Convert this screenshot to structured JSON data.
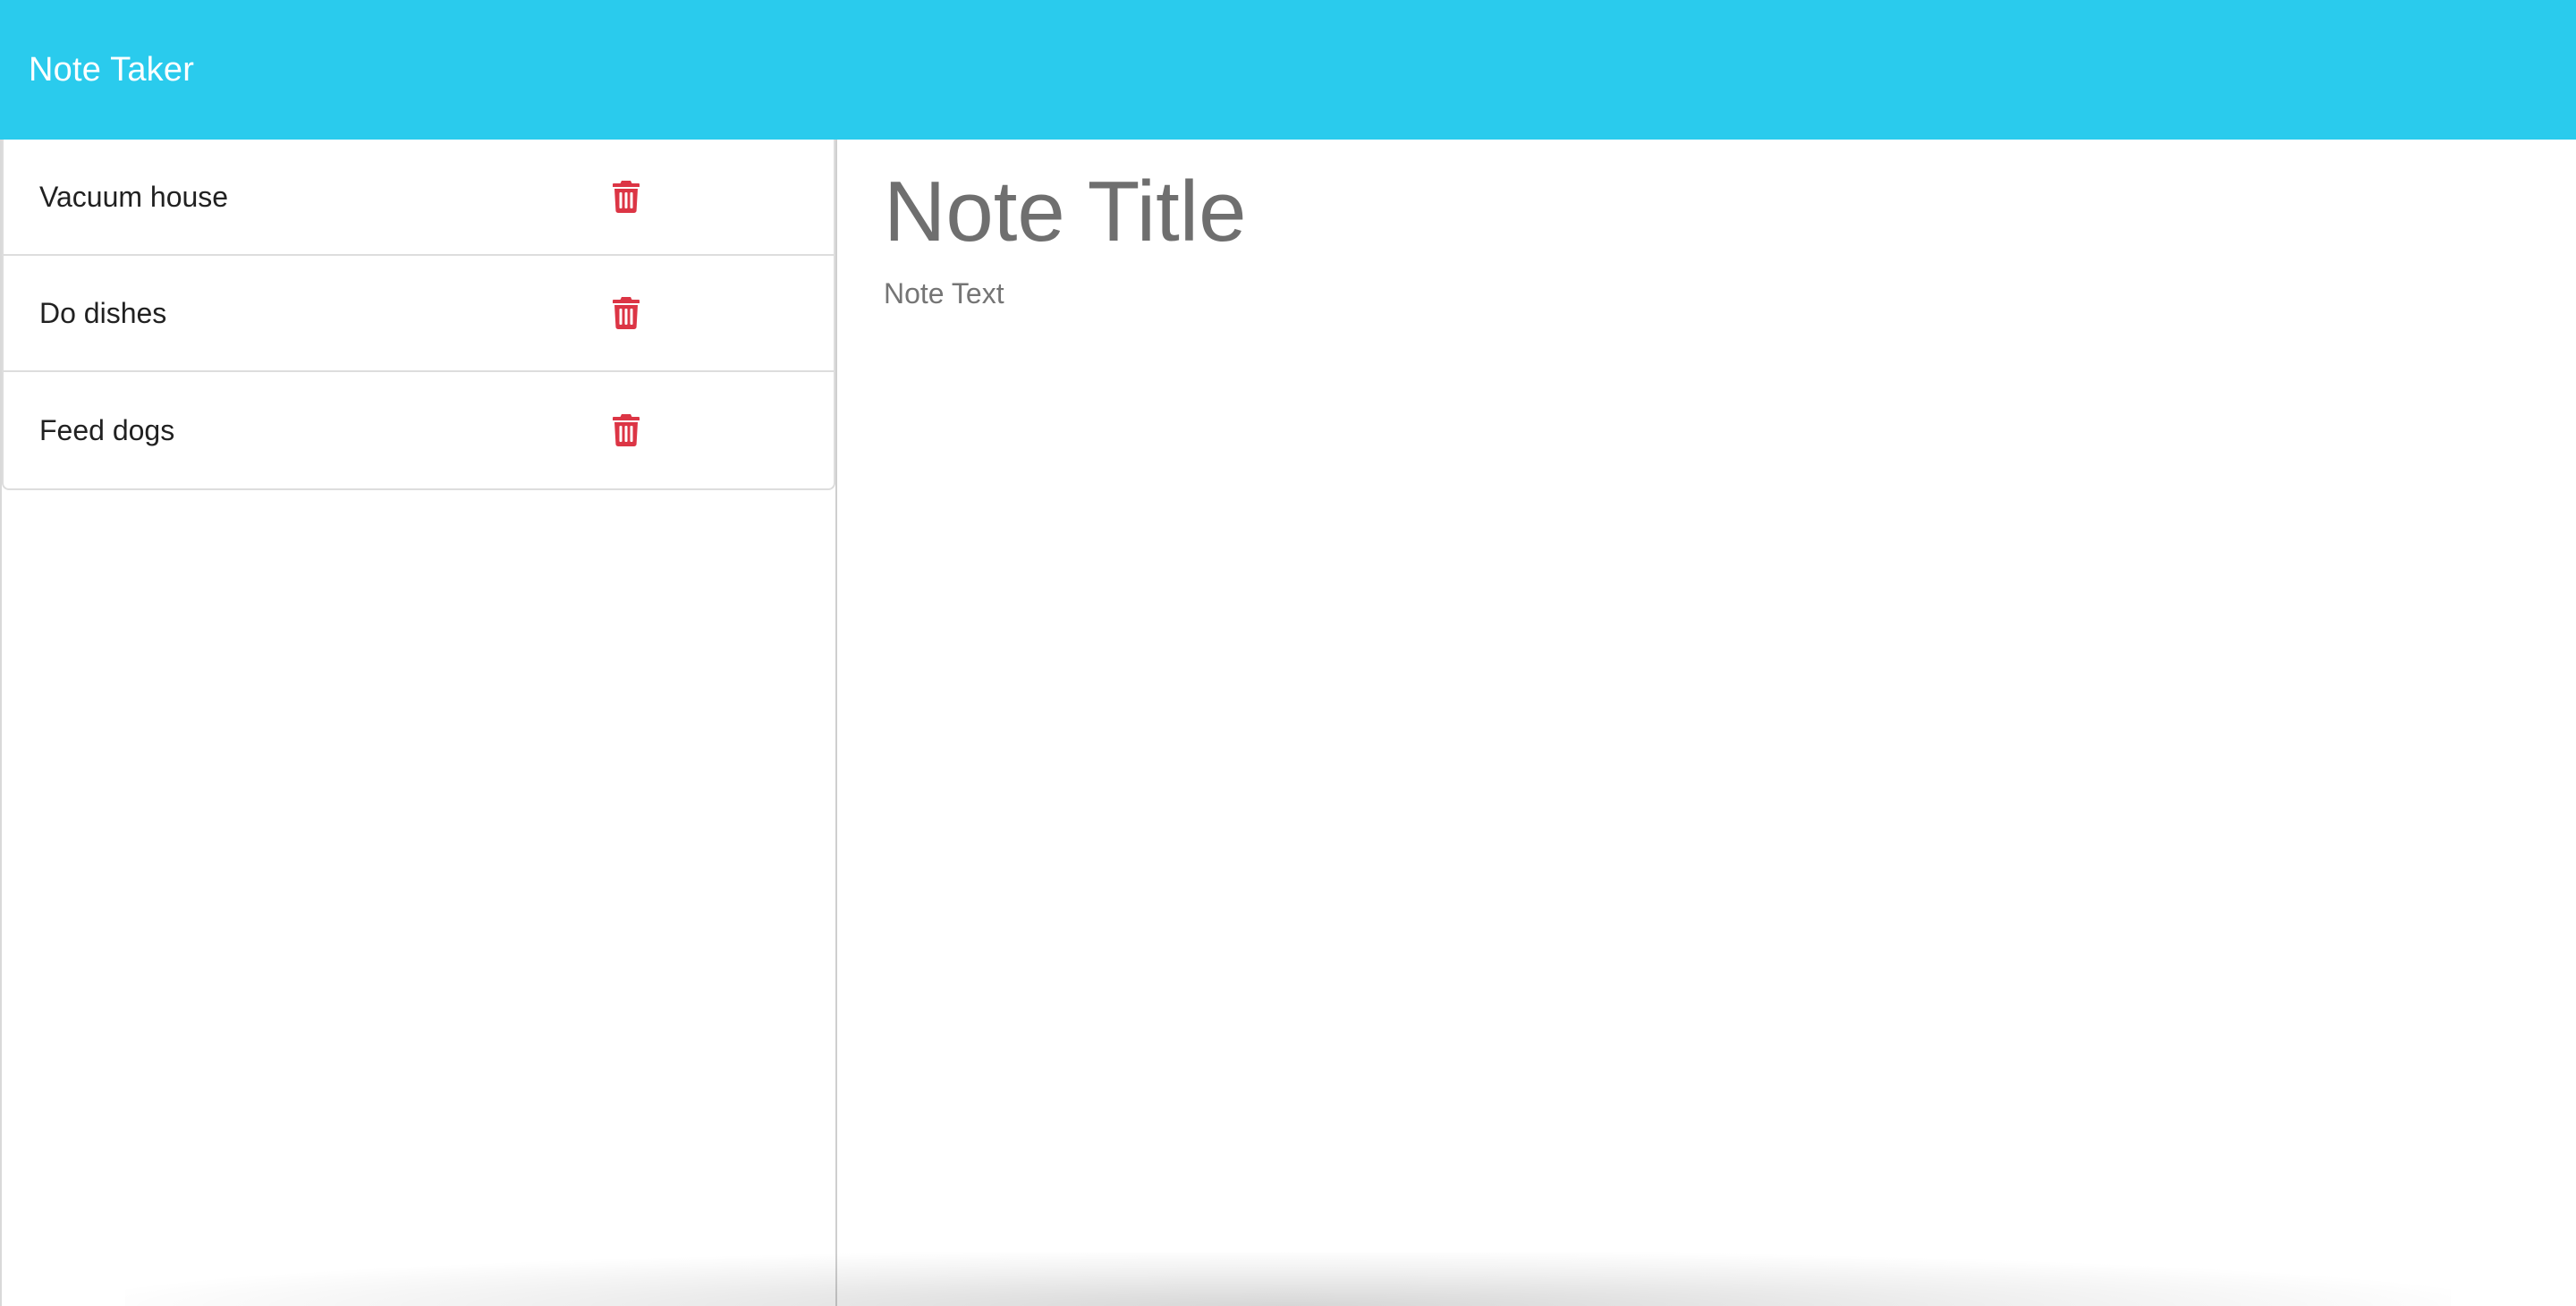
{
  "app": {
    "brand": "Note Taker"
  },
  "sidebar": {
    "notes": [
      {
        "title": "Vacuum house",
        "delete_icon": "trash-icon"
      },
      {
        "title": "Do dishes",
        "delete_icon": "trash-icon"
      },
      {
        "title": "Feed dogs",
        "delete_icon": "trash-icon"
      }
    ]
  },
  "editor": {
    "title_placeholder": "Note Title",
    "text_placeholder": "Note Text",
    "title_value": "",
    "text_value": ""
  },
  "colors": {
    "navbar": "#2acbed",
    "delete_icon": "#dc3545"
  }
}
